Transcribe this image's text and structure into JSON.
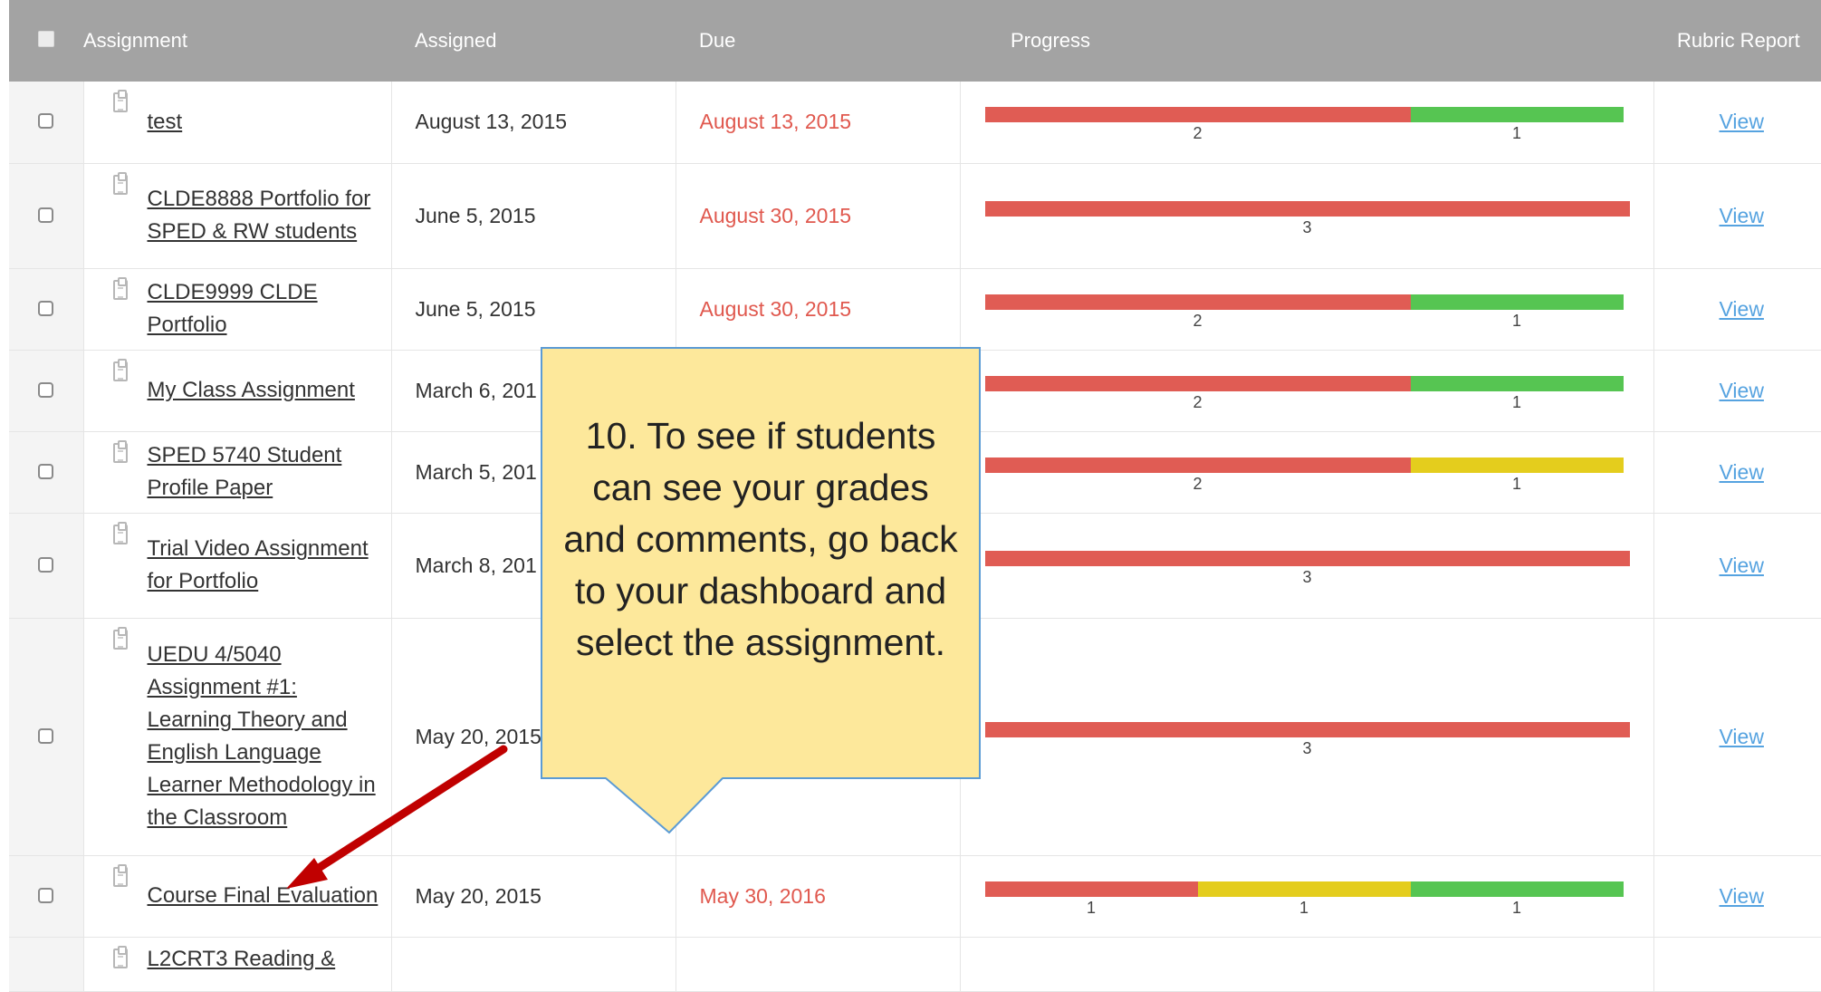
{
  "table": {
    "headers": {
      "assignment": "Assignment",
      "assigned": "Assigned",
      "due": "Due",
      "progress": "Progress",
      "rubric": "Rubric Report"
    },
    "rows": [
      {
        "title": "test",
        "assigned": "August 13, 2015",
        "due": "August 13, 2015",
        "progress": [
          {
            "status": "red",
            "count": "2"
          },
          {
            "status": "green",
            "count": "1"
          }
        ],
        "rubric": "View"
      },
      {
        "title": "CLDE8888 Portfolio for SPED & RW students",
        "assigned": "June 5, 2015",
        "due": "August 30, 2015",
        "progress": [
          {
            "status": "red",
            "count": "3"
          }
        ],
        "rubric": "View"
      },
      {
        "title": "CLDE9999 CLDE Portfolio",
        "assigned": "June 5, 2015",
        "due": "August 30, 2015",
        "progress": [
          {
            "status": "red",
            "count": "2"
          },
          {
            "status": "green",
            "count": "1"
          }
        ],
        "rubric": "View"
      },
      {
        "title": "My Class Assignment",
        "assigned": "March 6, 201",
        "due": "",
        "progress": [
          {
            "status": "red",
            "count": "2"
          },
          {
            "status": "green",
            "count": "1"
          }
        ],
        "rubric": "View"
      },
      {
        "title": "SPED 5740 Student Profile Paper",
        "assigned": "March 5, 201",
        "due": "",
        "progress": [
          {
            "status": "red",
            "count": "2"
          },
          {
            "status": "yellow",
            "count": "1"
          }
        ],
        "rubric": "View"
      },
      {
        "title": "Trial Video Assignment for Portfolio",
        "assigned": "March 8, 201",
        "due": "",
        "progress": [
          {
            "status": "red",
            "count": "3"
          }
        ],
        "rubric": "View"
      },
      {
        "title": "UEDU 4/5040 Assignment #1: Learning Theory and English Language Learner Methodology in the Classroom",
        "assigned": "May 20, 2015",
        "due": "",
        "progress": [
          {
            "status": "red",
            "count": "3"
          }
        ],
        "rubric": "View"
      },
      {
        "title": "Course Final Evaluation",
        "assigned": "May 20, 2015",
        "due": "May 30, 2016",
        "progress": [
          {
            "status": "red",
            "count": "1"
          },
          {
            "status": "yellow",
            "count": "1"
          },
          {
            "status": "green",
            "count": "1"
          }
        ],
        "rubric": "View"
      },
      {
        "title": "L2CRT3 Reading &",
        "assigned": "",
        "due": "",
        "progress": [],
        "rubric": ""
      }
    ]
  },
  "callout": {
    "text": "10. To see if students can see your grades and comments, go back to your dashboard and select the assignment."
  },
  "colors": {
    "red": "#e05c54",
    "green": "#56c552",
    "yellow": "#e4cd1d",
    "due_text": "#e0584e",
    "header_bg": "#a3a3a3",
    "link_blue": "#56a3e0",
    "callout_bg": "#fde89b",
    "callout_border": "#5b9bd5",
    "arrow": "#c00000"
  }
}
